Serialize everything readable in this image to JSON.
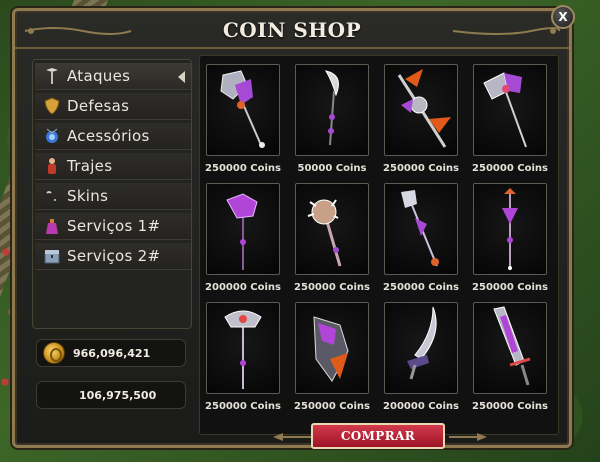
{
  "window": {
    "title": "COIN SHOP",
    "close_label": "X"
  },
  "sidebar": {
    "categories": [
      {
        "label": "Ataques",
        "icon": "sword-icon"
      },
      {
        "label": "Defesas",
        "icon": "shield-icon"
      },
      {
        "label": "Acessórios",
        "icon": "necklace-icon"
      },
      {
        "label": "Trajes",
        "icon": "costume-icon"
      },
      {
        "label": "Skins",
        "icon": "skin-icon"
      },
      {
        "label": "Serviços 1#",
        "icon": "bag-icon"
      },
      {
        "label": "Serviços 2#",
        "icon": "chest-icon"
      }
    ],
    "active_category": "Ataques"
  },
  "balances": {
    "gold": "966,096,421",
    "silver": "106,975,500"
  },
  "items": [
    {
      "price": "250000 Coins",
      "icon": "crystal-axe-icon"
    },
    {
      "price": "50000 Coins",
      "icon": "scythe-icon"
    },
    {
      "price": "250000 Coins",
      "icon": "winged-bow-icon"
    },
    {
      "price": "250000 Coins",
      "icon": "double-axe-icon"
    },
    {
      "price": "200000 Coins",
      "icon": "purple-axe-icon"
    },
    {
      "price": "250000 Coins",
      "icon": "spiked-mace-icon"
    },
    {
      "price": "250000 Coins",
      "icon": "crystal-staff-icon"
    },
    {
      "price": "250000 Coins",
      "icon": "spiked-staff-icon"
    },
    {
      "price": "250000 Coins",
      "icon": "ornate-staff-icon"
    },
    {
      "price": "250000 Coins",
      "icon": "flame-shield-icon"
    },
    {
      "price": "200000 Coins",
      "icon": "curved-blade-icon"
    },
    {
      "price": "250000 Coins",
      "icon": "great-sword-icon"
    }
  ],
  "buy_button_label": "COMPRAR",
  "colors": {
    "frame_gold": "#8e7a4e",
    "buy_button_red": "#b8213a",
    "weapon_purple": "#b145d8",
    "weapon_orange": "#e05a1a"
  }
}
